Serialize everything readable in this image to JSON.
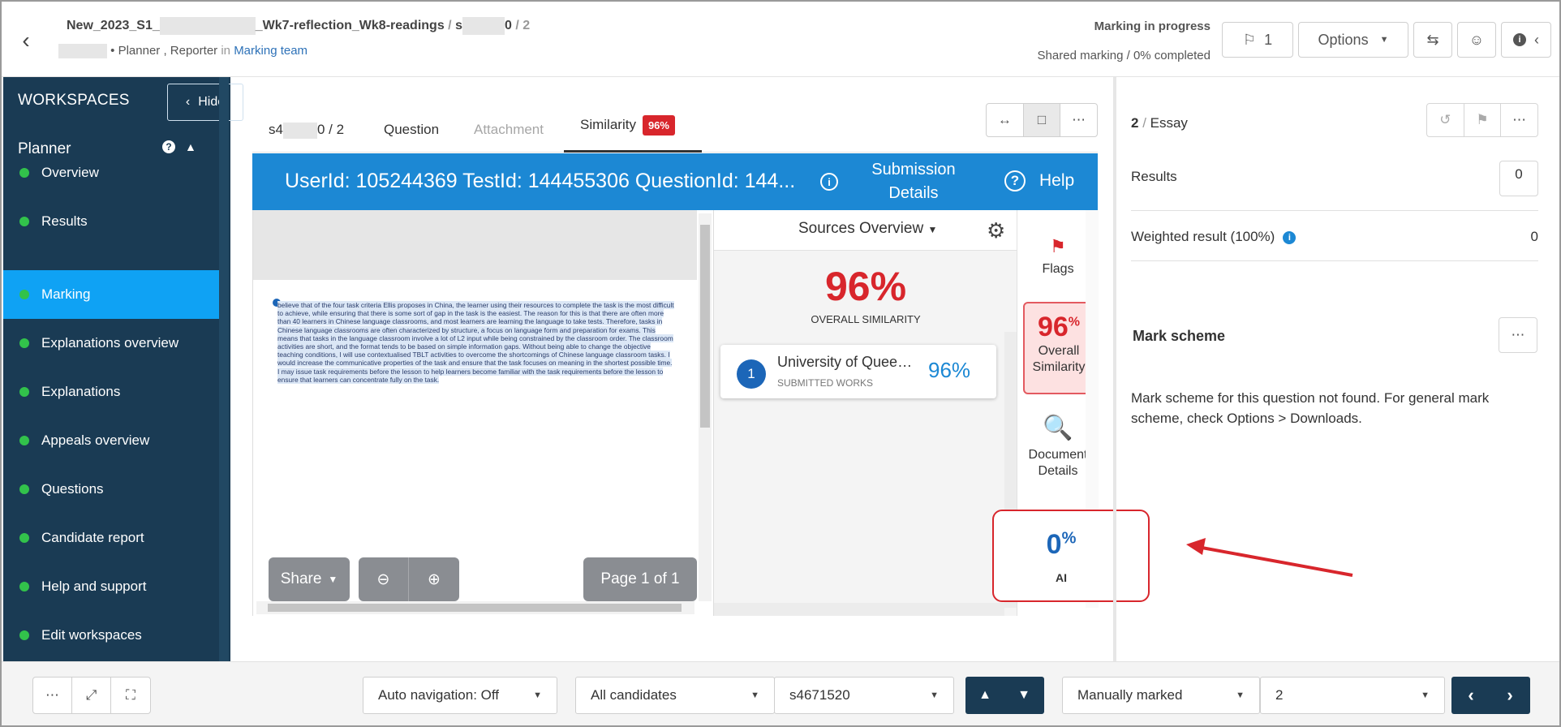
{
  "header": {
    "title_prefix": "New_2023_S1_",
    "title_mid": "_Wk7-reflection_Wk8-readings",
    "title_sep": " / ",
    "title_student": "s",
    "title_student_end": "0",
    "title_page": " / 2",
    "roles": "• Planner , Reporter",
    "in_word": "in",
    "team": "Marking team",
    "status": "Marking in progress",
    "shared": "Shared marking",
    "completed": " / 0% completed",
    "flag_count": "1",
    "options_label": "Options"
  },
  "sidebar": {
    "title": "WORKSPACES",
    "hide_label": "Hide",
    "section": "Planner",
    "items": [
      {
        "label": "Overview"
      },
      {
        "label": "Results"
      },
      {
        "label": "Marking",
        "active": true
      },
      {
        "label": "Explanations overview"
      },
      {
        "label": "Explanations"
      },
      {
        "label": "Appeals overview"
      },
      {
        "label": "Questions"
      },
      {
        "label": "Candidate report"
      },
      {
        "label": "Help and support"
      },
      {
        "label": "Edit workspaces"
      }
    ]
  },
  "tabs": {
    "student_prefix": "s4",
    "student_suffix": "0 / 2",
    "question": "Question",
    "attachment": "Attachment",
    "similarity": "Similarity",
    "similarity_badge": "96%"
  },
  "report": {
    "ids": "UserId: 105244369 TestId: 144455306 QuestionId: 144...",
    "submission_details": "Submission Details",
    "help": "Help",
    "document_text": "believe that of the four task criteria Ellis proposes in China, the learner using their resources to complete the task is the most difficult to achieve, while ensuring that there is some sort of gap in the task is the easiest. The reason for this is that there are often more than 40 learners in Chinese language classrooms, and most learners are learning the language to take tests. Therefore, tasks in Chinese language classrooms are often characterized by structure, a focus on language form and preparation for exams. This means that tasks in the language classroom involve a lot of L2 input while being constrained by the classroom order. The classroom activities are short, and the format tends to be based on simple information gaps. Without being able to change the objective teaching conditions, I will use contextualised TBLT activities to overcome the shortcomings of Chinese language classroom tasks. I would increase the communicative properties of the task and ensure that the task focuses on meaning in the shortest possible time. I may issue task requirements before the lesson to help learners become familiar with the task requirements before the lesson to ensure that learners can concentrate fully on the task.",
    "share": "Share",
    "page": "Page 1 of 1",
    "sources_title": "Sources Overview",
    "overall_pct": "96%",
    "overall_label": "OVERALL SIMILARITY",
    "source": {
      "num": "1",
      "name": "University of Queensland",
      "kind": "SUBMITTED WORKS",
      "pct": "96%"
    },
    "rail": {
      "flags": "Flags",
      "sim_num": "96",
      "sim_pct_sign": "%",
      "sim_label": "Overall Similarity",
      "doc_details": "Document Details",
      "ai_num": "0",
      "ai_pct_sign": "%",
      "ai_label": "AI"
    }
  },
  "right": {
    "q_num": "2",
    "q_type": "Essay",
    "results_label": "Results",
    "results_value": "0",
    "weighted_label": "Weighted result (100%)",
    "weighted_value": "0",
    "mark_scheme_title": "Mark scheme",
    "mark_scheme_text": "Mark scheme for this question not found. For general mark scheme, check Options > Downloads."
  },
  "footer": {
    "auto_nav": "Auto navigation: Off",
    "candidates": "All candidates",
    "candidate_id": "s4671520",
    "marked_mode": "Manually marked",
    "question_num": "2"
  },
  "colors": {
    "sidebar_bg": "#1a3b54",
    "active_blue": "#0fa2f4",
    "report_blue": "#1c88d4",
    "similarity_red": "#d8262c",
    "status_green": "#32c24b"
  }
}
